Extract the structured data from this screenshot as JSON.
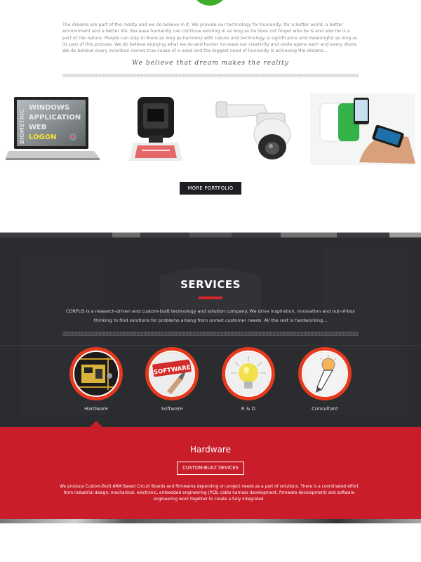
{
  "intro": {
    "paragraph": "The dreams are part of the reality and we do believe in it. We provide our technology for humanity, for a better world, a better environment and a better life. Because humanity can continue existing in as long as he does not forget who he is and also he is a part of the nature. People can stay in there as long as harmony with nature and technology is significance and meaningful as long as its part of this process. We do believe enjoying what we do and humor increase our creativity and smile opens each and every doors. We do believe every invention comes true cause of a need and the biggest need of humanity is achieving the dreams...",
    "quote": "We believe that dream makes the reality"
  },
  "portfolio": {
    "items": [
      {
        "name": "biometric-laptop",
        "screen_text": [
          "WINDOWS",
          "APPLICATION",
          "WEB",
          "LOGON"
        ],
        "side_text": "BIOMETRIC"
      },
      {
        "name": "fingerprint-scanner"
      },
      {
        "name": "security-dome-camera"
      },
      {
        "name": "mobile-health-device"
      }
    ],
    "more_button": "MORE PORTFOLIO"
  },
  "services": {
    "title": "SERVICES",
    "description": "CORPUS is a research-driven and custom-built technology and solution company. We drive inspiration, innovation and out-of-box thinking to find solutions for problems arising from unmet customer needs. All the rest is hardworking...",
    "items": [
      {
        "label": "Hardware",
        "icon": "circuit-board-icon"
      },
      {
        "label": "Software",
        "icon": "software-sign-icon",
        "badge": "SOFTWARE"
      },
      {
        "label": "R & D",
        "icon": "lightbulb-icon"
      },
      {
        "label": "Consultant",
        "icon": "pencil-bulb-icon"
      }
    ],
    "accent": "#d3262e",
    "circle_color": "#e53a1e"
  },
  "hardware": {
    "title": "Hardware",
    "button": "CUSTOM-BUILT DEVICES",
    "text": "We produce  Custom-Built ARM Based Circuit Boards and firmwares depending on project needs as a part of solutions. There is a coordinated effort from industrial design, mechanical, electronic, embedded engineering (PCB, cable harness development, firmware development) and software engineering work together to create a fully integrated.",
    "panel_color": "#c91d2a"
  }
}
